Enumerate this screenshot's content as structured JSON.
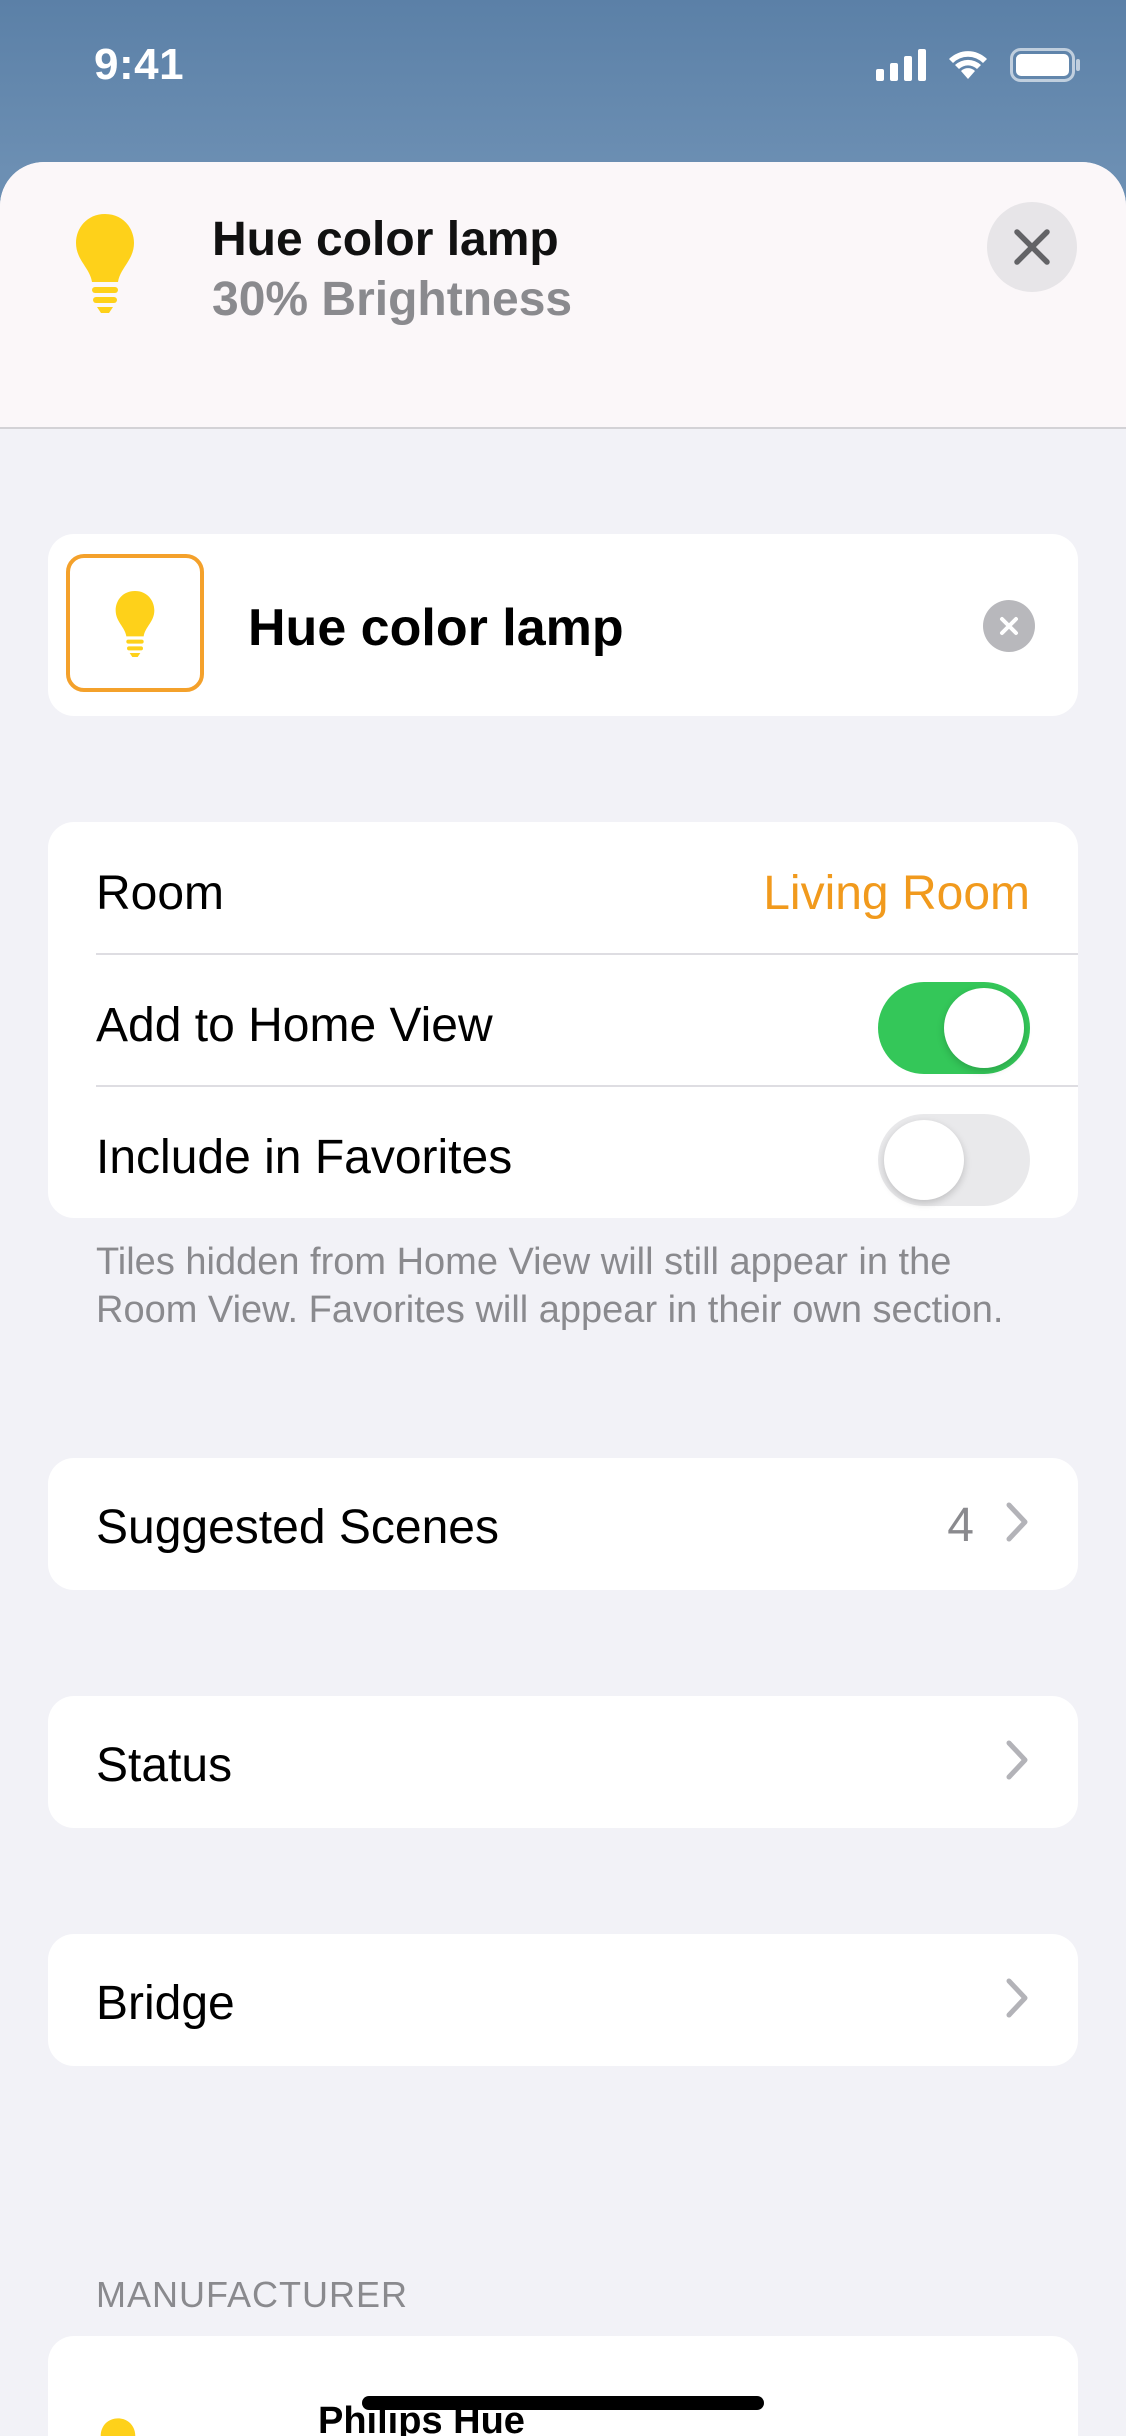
{
  "status_bar": {
    "time": "9:41"
  },
  "header": {
    "title": "Hue color lamp",
    "subtitle": "30% Brightness"
  },
  "name_field": {
    "value": "Hue color lamp"
  },
  "settings": {
    "room_label": "Room",
    "room_value": "Living Room",
    "home_view_label": "Add to Home View",
    "home_view_on": true,
    "favorites_label": "Include in Favorites",
    "favorites_on": false
  },
  "footnote": "Tiles hidden from Home View will still appear in the Room View. Favorites will appear in their own section.",
  "suggested_scenes": {
    "label": "Suggested Scenes",
    "count": "4"
  },
  "status_row": {
    "label": "Status"
  },
  "bridge_row": {
    "label": "Bridge"
  },
  "manufacturer": {
    "section_label": "MANUFACTURER",
    "name": "Philips Hue"
  },
  "colors": {
    "accent": "#f19a1d",
    "toggle_on": "#34c759",
    "bulb": "#fed11a"
  }
}
